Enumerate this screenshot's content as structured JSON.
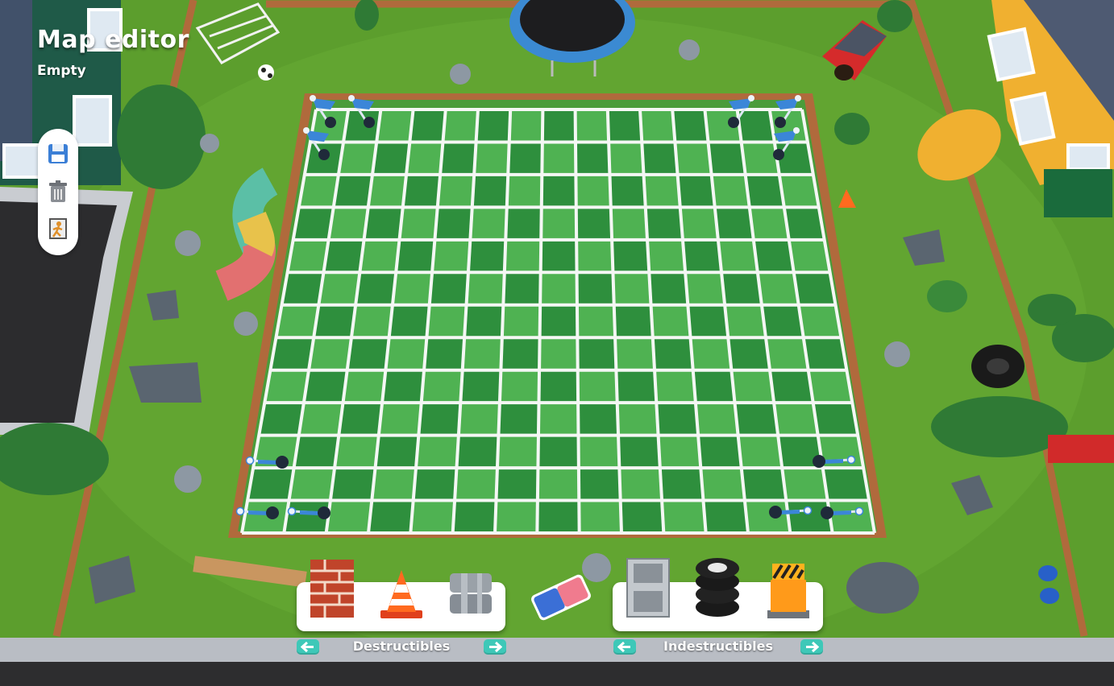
{
  "header": {
    "title": "Map editor",
    "subtitle": "Empty"
  },
  "toolbar": {
    "items": [
      "save-icon",
      "trash-icon",
      "exit-icon"
    ]
  },
  "board": {
    "columns": 15,
    "rows": 13,
    "colors": {
      "light": "#4fb252",
      "dark": "#2e8f3d",
      "lines": "#f4f7f4"
    }
  },
  "palette": {
    "destructibles": {
      "label": "Destructibles",
      "items": [
        "brick-wall",
        "traffic-cone",
        "metal-pipes"
      ]
    },
    "eraser": "eraser",
    "indestructibles": {
      "label": "Indestructibles",
      "items": [
        "steel-crate",
        "tire-stack",
        "hazard-block"
      ]
    }
  },
  "colors": {
    "accent": "#3ec8b8",
    "grass": "#5c9e2d",
    "fence": "#b06a3c",
    "flag": "#3b86d8"
  }
}
